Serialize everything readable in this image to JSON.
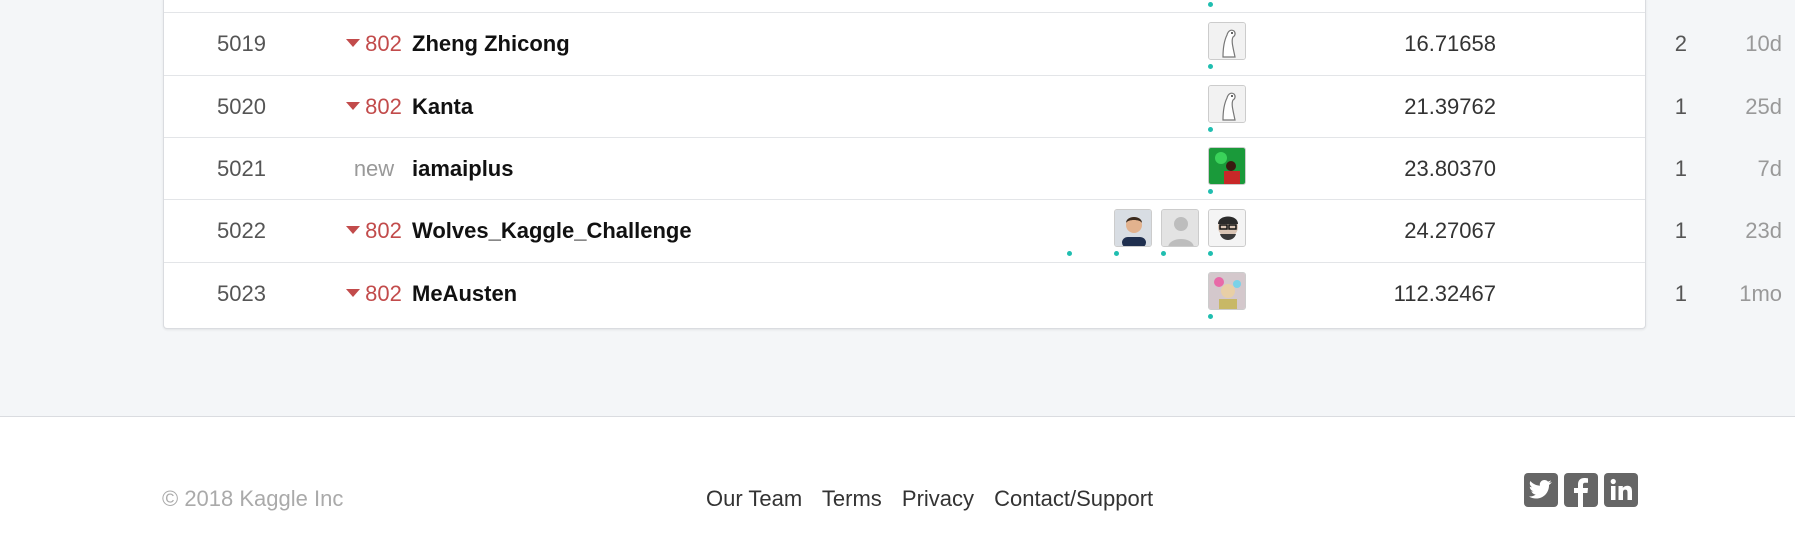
{
  "leaderboard": {
    "rows": [
      {
        "rank": "5019",
        "change": "802",
        "change_dir": "down",
        "team": "Zheng Zhicong",
        "score": "16.71658",
        "entries": "2",
        "last": "10d",
        "avatars": [
          "goose"
        ]
      },
      {
        "rank": "5020",
        "change": "802",
        "change_dir": "down",
        "team": "Kanta",
        "score": "21.39762",
        "entries": "1",
        "last": "25d",
        "avatars": [
          "goose"
        ]
      },
      {
        "rank": "5021",
        "change": "new",
        "change_dir": "new",
        "team": "iamaiplus",
        "score": "23.80370",
        "entries": "1",
        "last": "7d",
        "avatars": [
          "green-photo"
        ]
      },
      {
        "rank": "5022",
        "change": "802",
        "change_dir": "down",
        "team": "Wolves_Kaggle_Challenge",
        "score": "24.27067",
        "entries": "1",
        "last": "23d",
        "avatars": [
          "man-photo",
          "default-silhouette",
          "glasses-photo"
        ]
      },
      {
        "rank": "5023",
        "change": "802",
        "change_dir": "down",
        "team": "MeAusten",
        "score": "112.32467",
        "entries": "1",
        "last": "1mo",
        "avatars": [
          "colorful-photo"
        ]
      }
    ]
  },
  "footer": {
    "copyright": "© 2018 Kaggle Inc",
    "links": [
      "Our Team",
      "Terms",
      "Privacy",
      "Contact/Support"
    ],
    "social": [
      "twitter-icon",
      "facebook-icon",
      "linkedin-icon"
    ]
  },
  "colors": {
    "accent": "#20beb0",
    "down": "#c24b4b",
    "muted": "#999999"
  }
}
